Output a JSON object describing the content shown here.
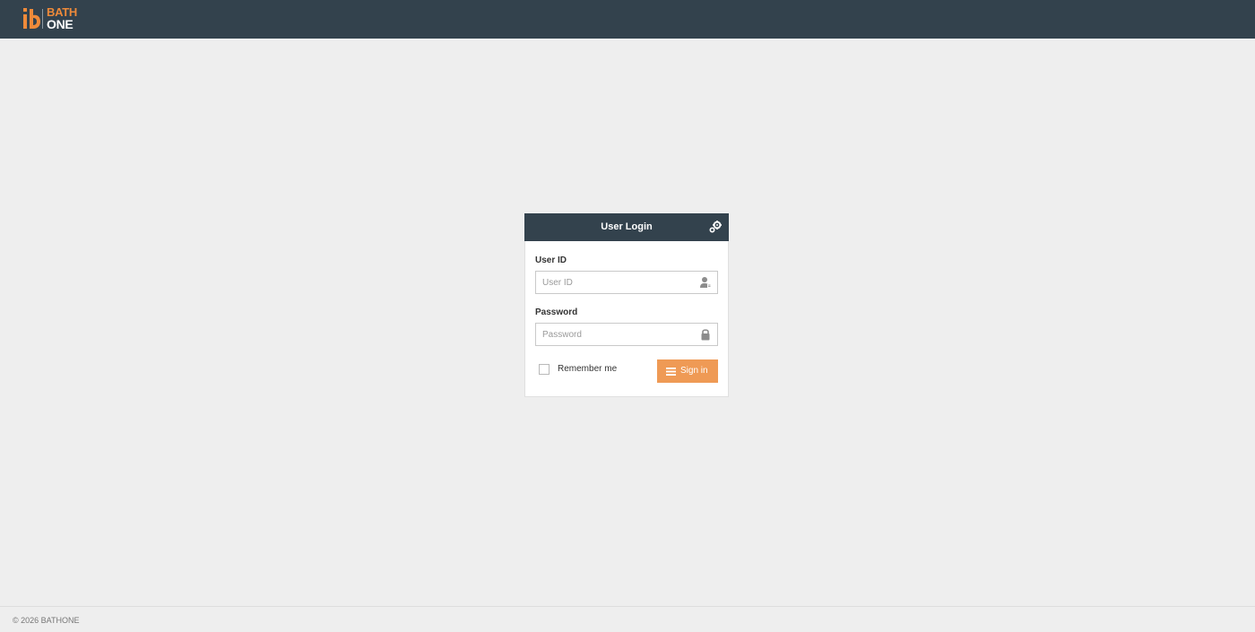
{
  "brand": {
    "line1": "BATH",
    "line2": "ONE",
    "accent_color": "#ee8a3a",
    "header_color": "#33424d"
  },
  "login": {
    "title": "User Login",
    "settings_icon": "gear-icon",
    "user_id": {
      "label": "User ID",
      "placeholder": "User ID",
      "value": "",
      "icon": "user-icon"
    },
    "password": {
      "label": "Password",
      "placeholder": "Password",
      "value": "",
      "icon": "lock-icon"
    },
    "remember_label": "Remember me",
    "remember_checked": false,
    "signin_label": "Sign in",
    "signin_icon": "menu-icon",
    "signin_color": "#ef9a55"
  },
  "footer": {
    "copyright": "© 2026 BATHONE"
  }
}
